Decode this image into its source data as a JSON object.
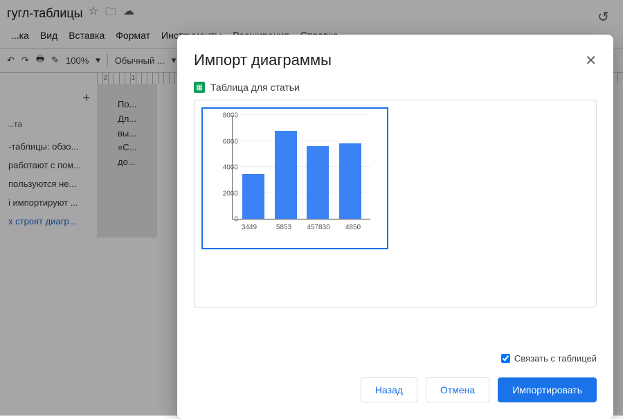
{
  "doc_title": "гугл-таблицы",
  "menus": [
    "...ка",
    "Вид",
    "Вставка",
    "Формат",
    "Инструменты",
    "Расширения",
    "Справка"
  ],
  "toolbar": {
    "zoom": "100%",
    "style": "Обычный ..."
  },
  "ruler_marks": [
    "2",
    "1",
    "1"
  ],
  "sidebar": {
    "header": "...та",
    "items": [
      "-таблицы: обзо...",
      "работают с пом...",
      "пользуются не...",
      "і импортируют ...",
      "х строят диагр..."
    ],
    "active_index": 4
  },
  "doc_text": [
    "По...",
    "Дл...",
    "вы...",
    "«С...",
    "до..."
  ],
  "dialog": {
    "title": "Импорт диаграммы",
    "source_name": "Таблица для статьи",
    "link_checkbox_label": "Связать с таблицей",
    "link_checked": true,
    "buttons": {
      "back": "Назад",
      "cancel": "Отмена",
      "import": "Импортировать"
    }
  },
  "chart_data": {
    "type": "bar",
    "categories": [
      "3449",
      "5853",
      "457830",
      "4850"
    ],
    "values": [
      3449,
      6800,
      5600,
      5800
    ],
    "ylim": [
      0,
      8000
    ],
    "yticks": [
      0,
      2000,
      4000,
      6000,
      8000
    ],
    "title": "",
    "xlabel": "",
    "ylabel": ""
  }
}
